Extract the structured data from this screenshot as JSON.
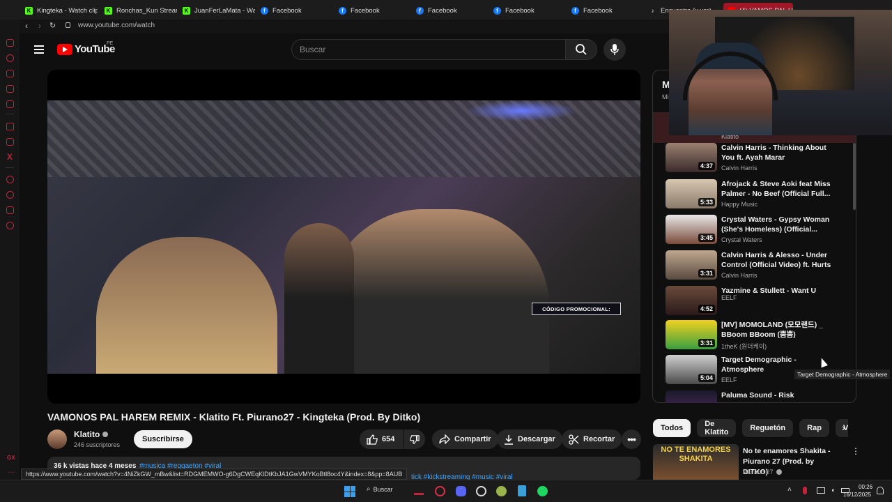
{
  "browser": {
    "tabs": [
      {
        "label": "Kingteka - Watch clip",
        "icon": "k"
      },
      {
        "label": "Ronchas_Kun Stream",
        "icon": "k"
      },
      {
        "label": "JuanFerLaMata - Wa",
        "icon": "k"
      },
      {
        "label": "Facebook",
        "icon": "f"
      },
      {
        "label": "Facebook",
        "icon": "f"
      },
      {
        "label": "Facebook",
        "icon": "f"
      },
      {
        "label": "Facebook",
        "icon": "f"
      },
      {
        "label": "Facebook",
        "icon": "f"
      },
      {
        "label": "Encuentra (y ver)",
        "icon": "t"
      },
      {
        "label": "(4) VAMOS PAL HARE",
        "icon": "yt"
      }
    ],
    "url": "www.youtube.com/watch"
  },
  "youtube": {
    "logo_text": "YouTube",
    "country_code": "PE",
    "search_placeholder": "Buscar"
  },
  "video": {
    "title": "VAMONOS PAL HAREM REMIX - Klatito Ft. Piurano27 - Kingteka (Prod. By Ditko)",
    "overlay_text": "CÓDIGO PROMOCIONAL:",
    "channel_name": "Klatito",
    "subscribers": "246 suscriptores",
    "subscribe_label": "Suscribirse",
    "likes": "654",
    "share_label": "Compartir",
    "download_label": "Descargar",
    "clip_label": "Recortar",
    "desc_meta": "36 k vistas hace 4 meses",
    "desc_tags": "#musica #reggaeton #viral",
    "desc_tags2": "tick #kickstreaming #music #viral"
  },
  "status_url": "https://www.youtube.com/watch?v=4NiZkGW_mBw&list=RDGMEMWO-g6DgCWEqKlDtKbJA1GwVMYKoBtl8oc4Y&index=8&pp=8AUB",
  "playlist": {
    "header_partial": "M",
    "header_sub": "Mi",
    "prev_channel": "Klatito",
    "items": [
      {
        "title": "Calvin Harris - Thinking About You ft. Ayah Marar",
        "channel": "Calvin Harris",
        "duration": "4:37"
      },
      {
        "title": "Afrojack & Steve Aoki feat Miss Palmer - No Beef (Official Full...",
        "channel": "Happy Music",
        "duration": "5:33"
      },
      {
        "title": "Crystal Waters - Gypsy Woman (She's Homeless) (Official...",
        "channel": "Crystal Waters",
        "duration": "3:45"
      },
      {
        "title": "Calvin Harris & Alesso - Under Control (Official Video) ft. Hurts",
        "channel": "Calvin Harris",
        "duration": "3:31"
      },
      {
        "title": "Yazmine & Stullett - Want U",
        "channel": "EELF",
        "duration": "4:52"
      },
      {
        "title": "[MV] MOMOLAND (모모랜드) _ BBoom BBoom (뿜뿜)",
        "channel": "1theK (원더케이)",
        "duration": "3:31"
      },
      {
        "title": "Target Demographic - Atmosphere",
        "channel": "EELF",
        "duration": "5:04"
      },
      {
        "title": "Paluma Sound - Risk",
        "channel": "",
        "duration": ""
      }
    ],
    "tooltip": "Target Demographic - Atmosphere"
  },
  "chips": [
    "Todos",
    "De Klatito",
    "Reguetón",
    "Rap",
    "Vide"
  ],
  "recommendation": {
    "thumb_text": "NO TE ENAMORES SHAKITA",
    "title": "No te enamores Shakita - Piurano 27 (Prod. by DITKO)",
    "channel": "Piurano 27"
  },
  "taskbar": {
    "search_label": "Buscar",
    "time": "00:26",
    "date": "16/12/2025"
  },
  "side_label": "GX",
  "colors": {
    "yt_red": "#ff0000",
    "opera_red": "#c0253a",
    "bg": "#0f0f0f"
  }
}
